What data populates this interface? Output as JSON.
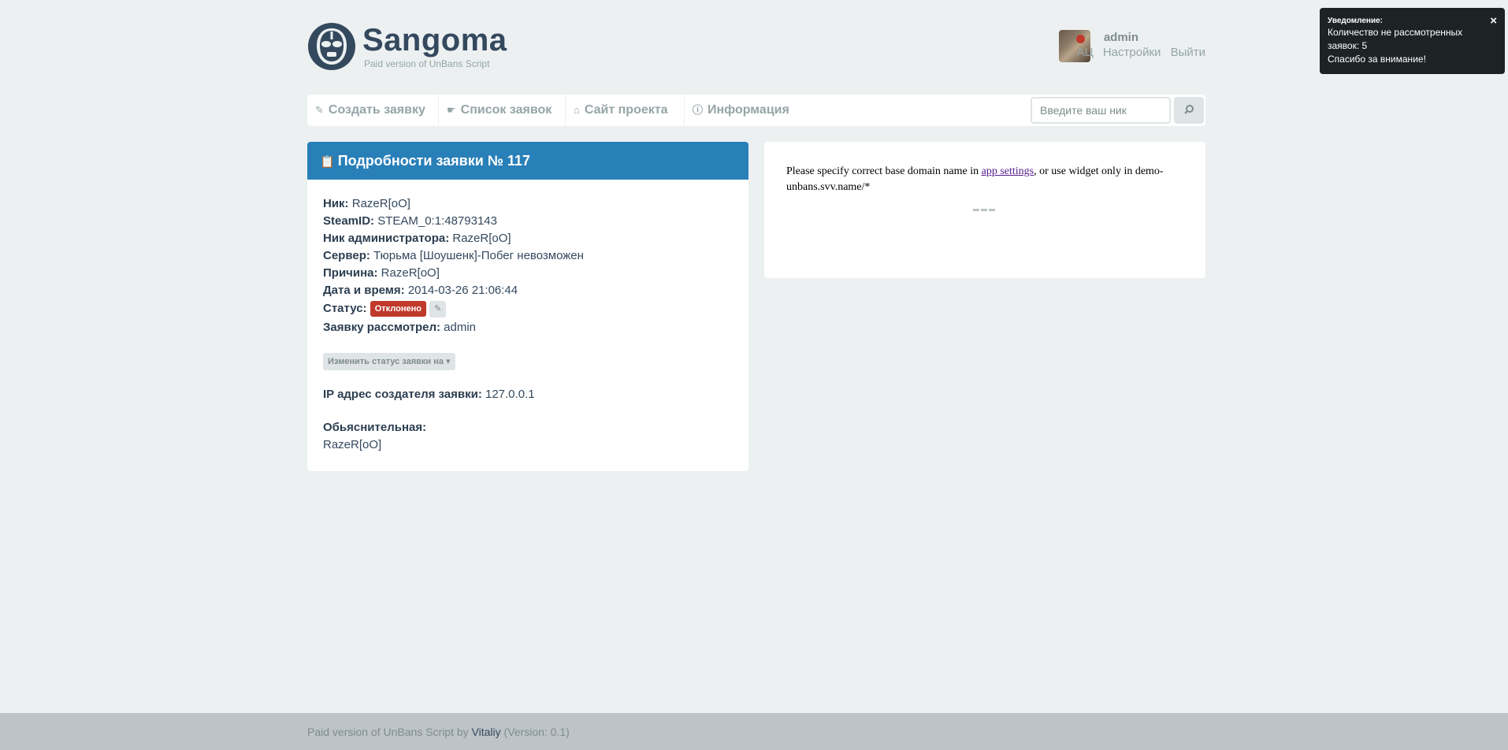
{
  "brand": {
    "name": "Sangoma",
    "subtitle": "Paid version of UnBans Script"
  },
  "user": {
    "name": "admin",
    "links": [
      "АЦ",
      "Настройки",
      "Выйти"
    ]
  },
  "nav": {
    "items": [
      {
        "label": "Создать заявку",
        "icon": "pencil-icon"
      },
      {
        "label": "Список заявок",
        "icon": "hand-icon"
      },
      {
        "label": "Сайт проекта",
        "icon": "home-icon"
      },
      {
        "label": "Информация",
        "icon": "info-icon"
      }
    ],
    "search_placeholder": "Введите ваш ник",
    "search_icon": "search-icon"
  },
  "request": {
    "title": "Подробности заявки № 117",
    "fields": {
      "nick_label": "Ник:",
      "nick": "RazeR[oO]",
      "steamid_label": "SteamID:",
      "steamid": "STEAM_0:1:48793143",
      "admin_nick_label": "Ник администратора:",
      "admin_nick": "RazeR[oO]",
      "server_label": "Сервер:",
      "server": "Тюрьма [Шоушенк]-Побег невозможен",
      "reason_label": "Причина:",
      "reason": "RazeR[oO]",
      "datetime_label": "Дата и время:",
      "datetime": "2014-03-26 21:06:44",
      "status_label": "Статус:",
      "status": "Отклонено",
      "reviewer_label": "Заявку рассмотрел:",
      "reviewer": "admin"
    },
    "change_status_label": "Изменить статус заявки на",
    "ip_label": "IP адрес создателя заявки:",
    "ip": "127.0.0.1",
    "explanation_label": "Обьяснительная:",
    "explanation": "RazeR[oO]"
  },
  "widget": {
    "msg_before": "Please specify correct base domain name in ",
    "link": "app settings",
    "msg_after": ", or use widget only in demo-unbans.svv.name/*"
  },
  "notification": {
    "title": "Уведомление:",
    "line1": "Количество не рассмотренных заявок: 5",
    "line2": "Спасибо за внимание!",
    "close": "×"
  },
  "footer": {
    "before": "Paid version of UnBans Script by ",
    "author": "Vitaliy",
    "after": " (Version: 0.1)"
  },
  "colors": {
    "accent": "#2980b9",
    "danger": "#c0392b",
    "background": "#ecf0f1",
    "footer": "#bdc3c7"
  }
}
